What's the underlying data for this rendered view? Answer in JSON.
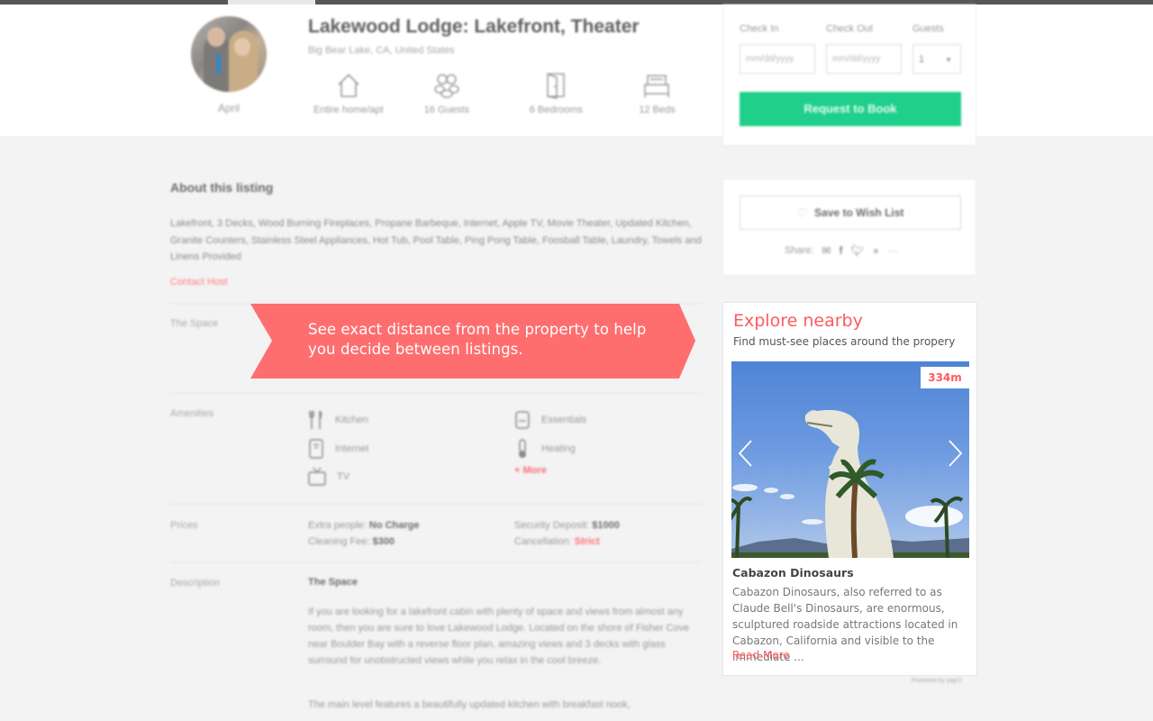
{
  "header": {
    "host_name": "April",
    "title": "Lakewood Lodge: Lakefront, Theater",
    "location": "Big Bear Lake, CA, United States",
    "specs": [
      {
        "icon": "house-icon",
        "label": "Entire home/apt"
      },
      {
        "icon": "guests-icon",
        "label": "16 Guests"
      },
      {
        "icon": "door-icon",
        "label": "6 Bedrooms"
      },
      {
        "icon": "bed-icon",
        "label": "12 Beds"
      }
    ]
  },
  "booking": {
    "check_in_label": "Check In",
    "check_out_label": "Check Out",
    "guests_label": "Guests",
    "check_in_placeholder": "mm/dd/yyyy",
    "check_out_placeholder": "mm/dd/yyyy",
    "guests_value": "1",
    "request_button": "Request to Book",
    "accent_color": "#1fcf8a"
  },
  "about": {
    "title": "About this listing",
    "text": "Lakefront, 3 Decks, Wood Burning Fireplaces, Propane Barbeque, Internet, Apple TV, Movie Theater, Updated Kitchen, Granite Counters, Stainless Steel Appliances, Hot Tub, Pool Table, Ping Pong Table, Foosball Table, Laundry, Towels and Linens Provided",
    "contact_host": "Contact Host"
  },
  "sections": {
    "space_label": "The Space",
    "amenities_label": "Amenities",
    "prices_label": "Prices",
    "description_label": "Description"
  },
  "amenities": [
    {
      "icon": "kitchen-icon",
      "label": "Kitchen"
    },
    {
      "icon": "internet-icon",
      "label": "Internet"
    },
    {
      "icon": "tv-icon",
      "label": "TV"
    },
    {
      "icon": "essentials-icon",
      "label": "Essentials"
    },
    {
      "icon": "heating-icon",
      "label": "Heating"
    }
  ],
  "amenities_more": "+ More",
  "prices": {
    "extra_people_label": "Extra people:",
    "extra_people_value": "No Charge",
    "cleaning_fee_label": "Cleaning Fee:",
    "cleaning_fee_value": "$300",
    "security_deposit_label": "Security Deposit:",
    "security_deposit_value": "$1000",
    "cancellation_label": "Cancellation:",
    "cancellation_value": "Strict"
  },
  "description": {
    "subtitle": "The Space",
    "paragraph1": "If you are looking for a lakefront cabin with plenty of space and views from almost any room, then you are sure to love Lakewood Lodge. Located on the shore of Fisher Cove near Boulder Bay with a reverse floor plan, amazing views and 3 decks with glass surround for unobstructed views while you relax in the cool breeze.",
    "paragraph2": "The main level features a beautifully updated kitchen with breakfast nook,"
  },
  "wishlist": {
    "button": "Save to Wish List",
    "share_label": "Share:",
    "share_icons": [
      "email-icon",
      "facebook-icon",
      "twitter-icon",
      "pinterest-icon",
      "more-icon"
    ]
  },
  "tooltip": {
    "text": "See exact distance from the property to help you decide between listings.",
    "color": "#ff6e6f"
  },
  "explore": {
    "title": "Explore nearby",
    "subtitle": "Find must-see places around the propery",
    "distance": "334m",
    "place_name": "Cabazon Dinosaurs",
    "place_description": "Cabazon Dinosaurs, also referred to as Claude Bell's Dinosaurs, are enormous, sculptured roadside attractions located in Cabazon, California and visible to the immediate ...",
    "read_more": "Read More",
    "accent_color": "#ff5a5f"
  },
  "footer": {
    "powered_by": "Powered by yap!2"
  }
}
